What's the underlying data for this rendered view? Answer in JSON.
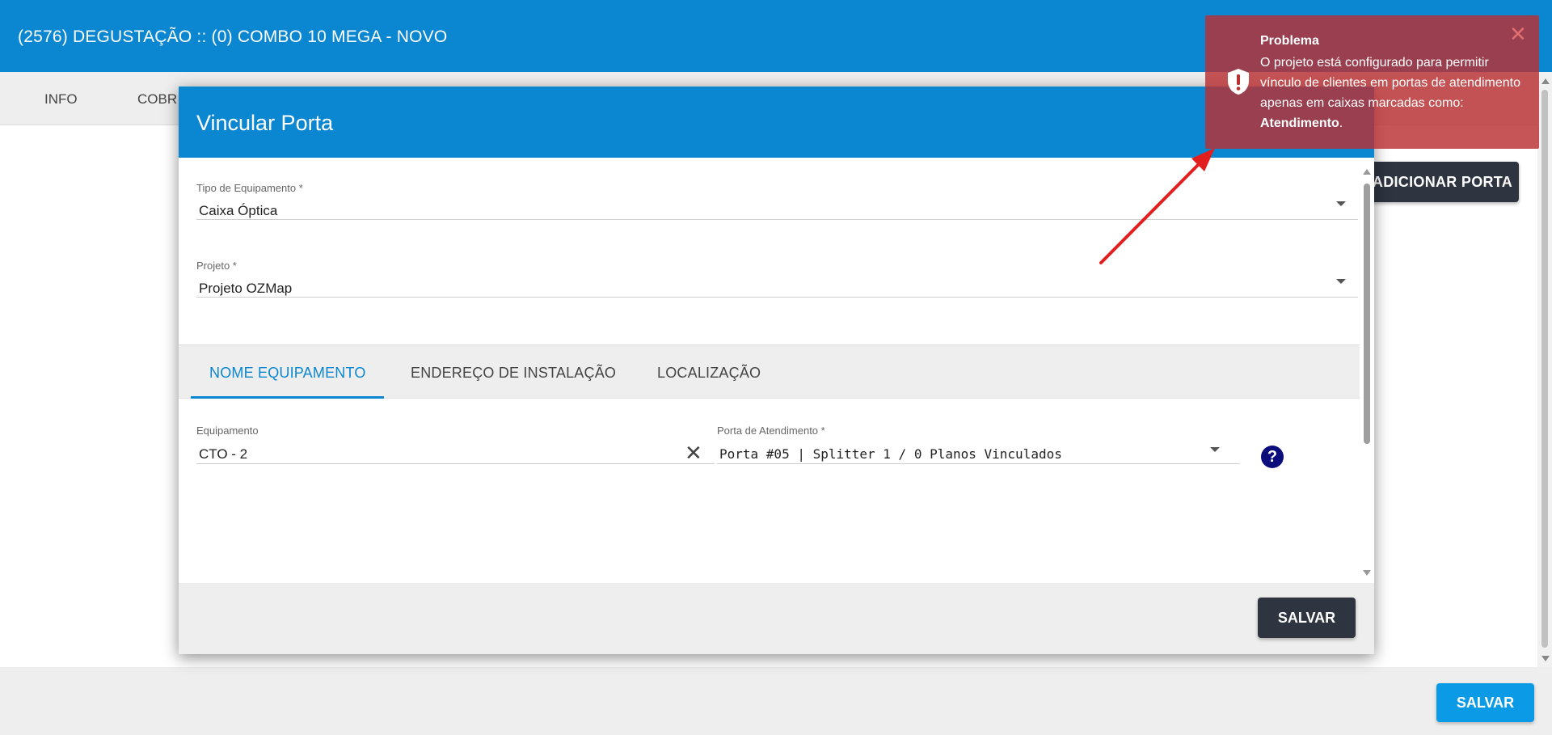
{
  "header": {
    "title": "(2576) DEGUSTAÇÃO :: (0) COMBO 10 MEGA - NOVO"
  },
  "background_tabs": [
    "INFO",
    "COBR"
  ],
  "add_port_button": "ADICIONAR PORTA",
  "footer": {
    "save_label": "SALVAR"
  },
  "modal": {
    "title": "Vincular Porta",
    "equipment_type": {
      "label": "Tipo de Equipamento *",
      "value": "Caixa Óptica"
    },
    "project": {
      "label": "Projeto *",
      "value": "Projeto OZMap"
    },
    "tabs": [
      {
        "label": "NOME EQUIPAMENTO",
        "active": true
      },
      {
        "label": "ENDEREÇO DE INSTALAÇÃO",
        "active": false
      },
      {
        "label": "LOCALIZAÇÃO",
        "active": false
      }
    ],
    "equipment": {
      "label": "Equipamento",
      "value": "CTO - 2"
    },
    "service_port": {
      "label": "Porta de Atendimento *",
      "value": "Porta #05 | Splitter 1 / 0 Planos Vinculados"
    },
    "save_label": "SALVAR"
  },
  "toast": {
    "title": "Problema",
    "message_prefix": "O projeto está configurado para permitir vínculo de clientes em portas de atendimento apenas em caixas marcadas como: ",
    "message_bold": "Atendimento",
    "message_suffix": ".",
    "close_symbol": "✕"
  },
  "colors": {
    "primary": "#0b87d1",
    "dark_button": "#2e3440",
    "toast_bg": "#b93032",
    "annotation_arrow": "#e31e1e"
  }
}
